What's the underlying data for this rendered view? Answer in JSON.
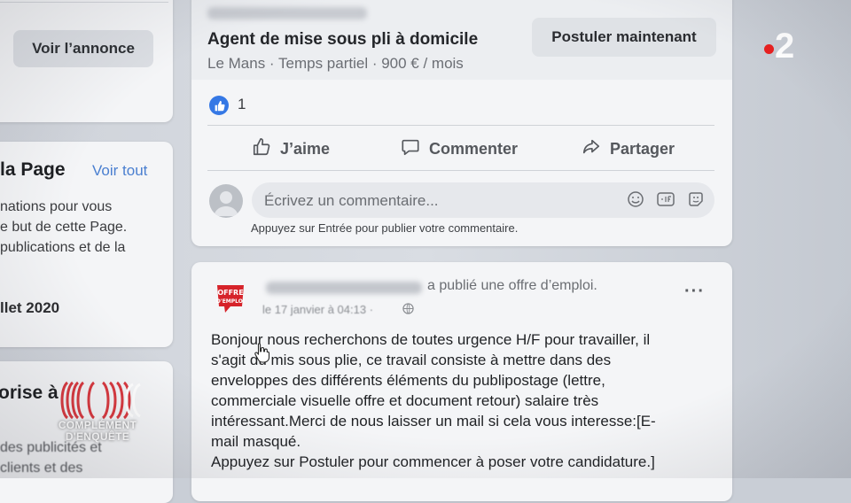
{
  "left_column": {
    "voir_annonce_label": "Voir l’annonce",
    "page_title": "la Page",
    "voir_tout_label": "Voir tout",
    "about_text": "nations pour vous\ne but de cette Page.\npublications et de la",
    "date_text": "llet 2020",
    "section_title": "orise à",
    "section_text": "des publicités et\nclients et des"
  },
  "job": {
    "title": "Agent de mise sous pli à domicile",
    "meta": "Le Mans · Temps partiel · 900 € / mois",
    "apply_label": "Postuler maintenant",
    "like_count": "1",
    "actions": {
      "like": "J’aime",
      "comment": "Commenter",
      "share": "Partager"
    },
    "comment_placeholder": "Écrivez un commentaire...",
    "comment_hint": "Appuyez sur Entrée pour publier votre commentaire."
  },
  "post": {
    "logo_text": "OFFRE D'EMPLOI",
    "posted_text": "a publié une offre d’emploi.",
    "date": "le 17 janvier à 04:13 ·",
    "more_label": "···",
    "body": "Bonjour nous recherchons de toutes urgence H/F pour travailler, il\ns'agit du mis sous plie, ce travail consiste à mettre dans des\nenveloppes des différents éléments du publipostage (lettre,\ncommerciale visuelle offre et document retour) salaire très\nintéressant.Merci de nous laisser un mail si cela vous interesse:[E-\nmail masqué.\nAppuyez sur Postuler pour commencer à poser votre candidature.]"
  },
  "overlay": {
    "channel_number": "2",
    "show_name": "COMPLÉMENT\nD'ENQUÊTE"
  },
  "colors": {
    "accent_blue": "#3578e5",
    "channel_red": "#e8201f",
    "logo_red": "#d6232a"
  }
}
